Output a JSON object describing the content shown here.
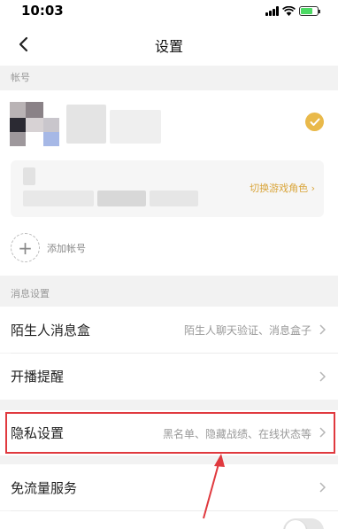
{
  "status_bar": {
    "time": "10:03",
    "battery_level": 0.7
  },
  "nav": {
    "title": "设置"
  },
  "sections": {
    "account": "帐号",
    "messages": "消息设置"
  },
  "account": {
    "switch_role_label": "切换游戏角色"
  },
  "add_account_label": "添加帐号",
  "settings": {
    "stranger_box": {
      "label": "陌生人消息盒",
      "detail": "陌生人聊天验证、消息盒子"
    },
    "live_reminder": {
      "label": "开播提醒"
    },
    "privacy": {
      "label": "隐私设置",
      "detail": "黑名单、隐藏战绩、在线状态等"
    },
    "free_data": {
      "label": "免流量服务"
    }
  },
  "colors": {
    "accent": "#e9b94a",
    "link": "#d9a53b",
    "highlight": "#e0393e"
  }
}
